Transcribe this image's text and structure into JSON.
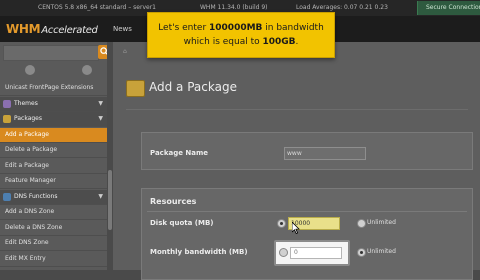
{
  "system_bar": {
    "os": "CENTOS 5.8 x86_64 standard – server1",
    "version": "WHM 11.34.0 (build 9)",
    "load": "Load Averages: 0.07 0.21 0.23",
    "secure": "Secure Connection"
  },
  "brand": {
    "logo_main": "WHM",
    "logo_accent": "Accelerated"
  },
  "nav": {
    "news": "News"
  },
  "sidebar": {
    "items": [
      {
        "label": "Unicast FrontPage Extensions",
        "type": "item"
      },
      {
        "label": "Themes",
        "type": "header",
        "icon_color": "#8a6fb0"
      },
      {
        "label": "Packages",
        "type": "header",
        "icon_color": "#c8a23a"
      },
      {
        "label": "Add a Package",
        "type": "active"
      },
      {
        "label": "Delete a Package",
        "type": "item"
      },
      {
        "label": "Edit a Package",
        "type": "item"
      },
      {
        "label": "Feature Manager",
        "type": "item"
      },
      {
        "label": "DNS Functions",
        "type": "header",
        "icon_color": "#4d7fb0"
      },
      {
        "label": "Add a DNS Zone",
        "type": "item"
      },
      {
        "label": "Delete a DNS Zone",
        "type": "item"
      },
      {
        "label": "Edit DNS Zone",
        "type": "item"
      },
      {
        "label": "Edit MX Entry",
        "type": "item"
      }
    ]
  },
  "main": {
    "page_title": "Add a Package",
    "package_name_label": "Package Name",
    "package_name_value": "www",
    "resources_title": "Resources",
    "disk_quota_label": "Disk quota (MB)",
    "disk_quota_value": "10000",
    "unlimited_label": "Unlimited",
    "bandwidth_label": "Monthly bandwidth (MB)",
    "bandwidth_value": "0"
  },
  "tooltip": {
    "line1_pre": "Let's enter ",
    "line1_bold": "100000MB",
    "line1_post": " in bandwidth",
    "line2_pre": "which is equal to ",
    "line2_bold": "100GB",
    "line2_post": "."
  },
  "colors": {
    "accent_orange": "#d98a1f",
    "tooltip_yellow": "#f2c300"
  }
}
